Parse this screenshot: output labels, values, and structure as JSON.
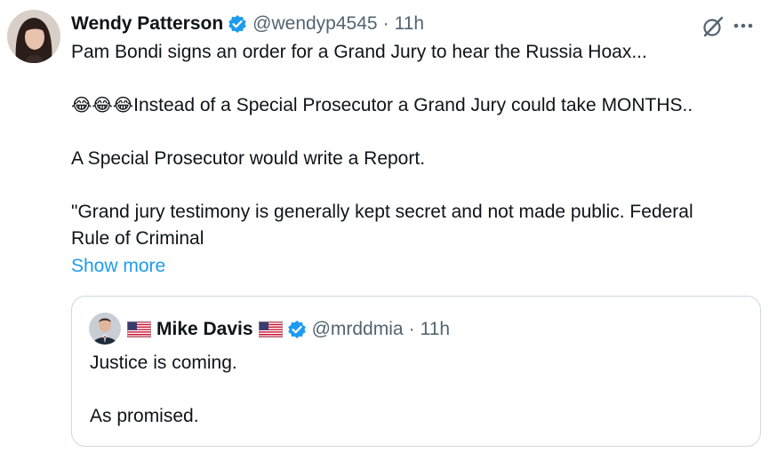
{
  "tweet": {
    "author": {
      "name": "Wendy Patterson",
      "handle": "@wendyp4545",
      "time": "11h"
    },
    "lines": [
      "Pam Bondi signs an order for a Grand Jury to hear the Russia Hoax...",
      "Instead of a Special Prosecutor a Grand Jury could take MONTHS..",
      "A Special Prosecutor would write a Report.",
      "\"Grand jury testimony is generally kept secret and not made public. Federal",
      "Rule of Criminal"
    ],
    "emojis": "😂😂😂",
    "show_more": "Show more"
  },
  "quoted": {
    "author": {
      "name": "Mike Davis",
      "handle": "@mrddmia",
      "time": "11h"
    },
    "lines": [
      "Justice is coming.",
      "As promised."
    ]
  },
  "icons": {
    "verified": "verified-badge-icon",
    "grok": "grok-icon",
    "more": "more-dots-icon",
    "flag": "us-flag-icon"
  },
  "colors": {
    "verified": "#1d9bf0",
    "link": "#1d9bf0",
    "secondary": "#536471",
    "border": "#cfd9de"
  },
  "separator": "·"
}
